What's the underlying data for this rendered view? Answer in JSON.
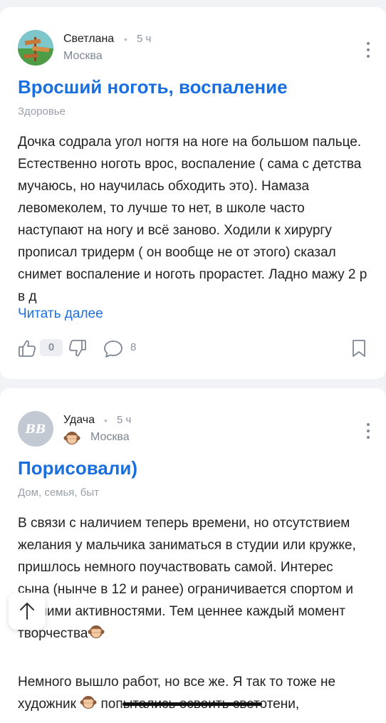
{
  "posts": [
    {
      "author": "Светлана",
      "separator": "•",
      "time": "5 ч",
      "city": "Москва",
      "title": "Вросший ноготь, воспаление",
      "category": "Здоровье",
      "body": "Дочка содрала угол ногтя на ноге на большом пальце. Естественно ноготь врос, воспаление ( сама с детства мучаюсь, но научилась обходить это). Намаза левомеколем, то лучше то нет, в школе часто наступают на ногу и всё заново. Ходили к хирургу прописал тридерм ( он вообще не от этого) сказал снимет воспаление и ноготь прорастет. Ладно мажу 2 р в д",
      "read_more": "Читать далее",
      "likes": "0",
      "comments": "8"
    },
    {
      "author": "Удача",
      "avatar_initials": "BB",
      "separator": "•",
      "time": "5 ч",
      "city": "Москва",
      "title": "Порисовали)",
      "category": "Дом, семья, быт",
      "body": "В связи с наличием теперь времени, но отсутствием желания у мальчика заниматься в студии или кружке, пришлось немного поучаствовать самой. Интерес сына (нынче в 12 и ранее) ограничивается спортом и прочими активностями. Тем ценнее каждый момент творчества",
      "body2_before": "Немного вышло работ, но все же. Я так то тоже не художник",
      "body2_after": "попытались освоить светотени,"
    }
  ],
  "icons": [
    "thumbs-up-icon",
    "thumbs-down-icon",
    "comment-icon",
    "bookmark-icon",
    "more-icon",
    "arrow-up-icon",
    "see-no-evil-monkey-icon"
  ],
  "colors": {
    "accent": "#1a6fe0",
    "background": "#f2f3f6",
    "muted": "#8b939f"
  }
}
